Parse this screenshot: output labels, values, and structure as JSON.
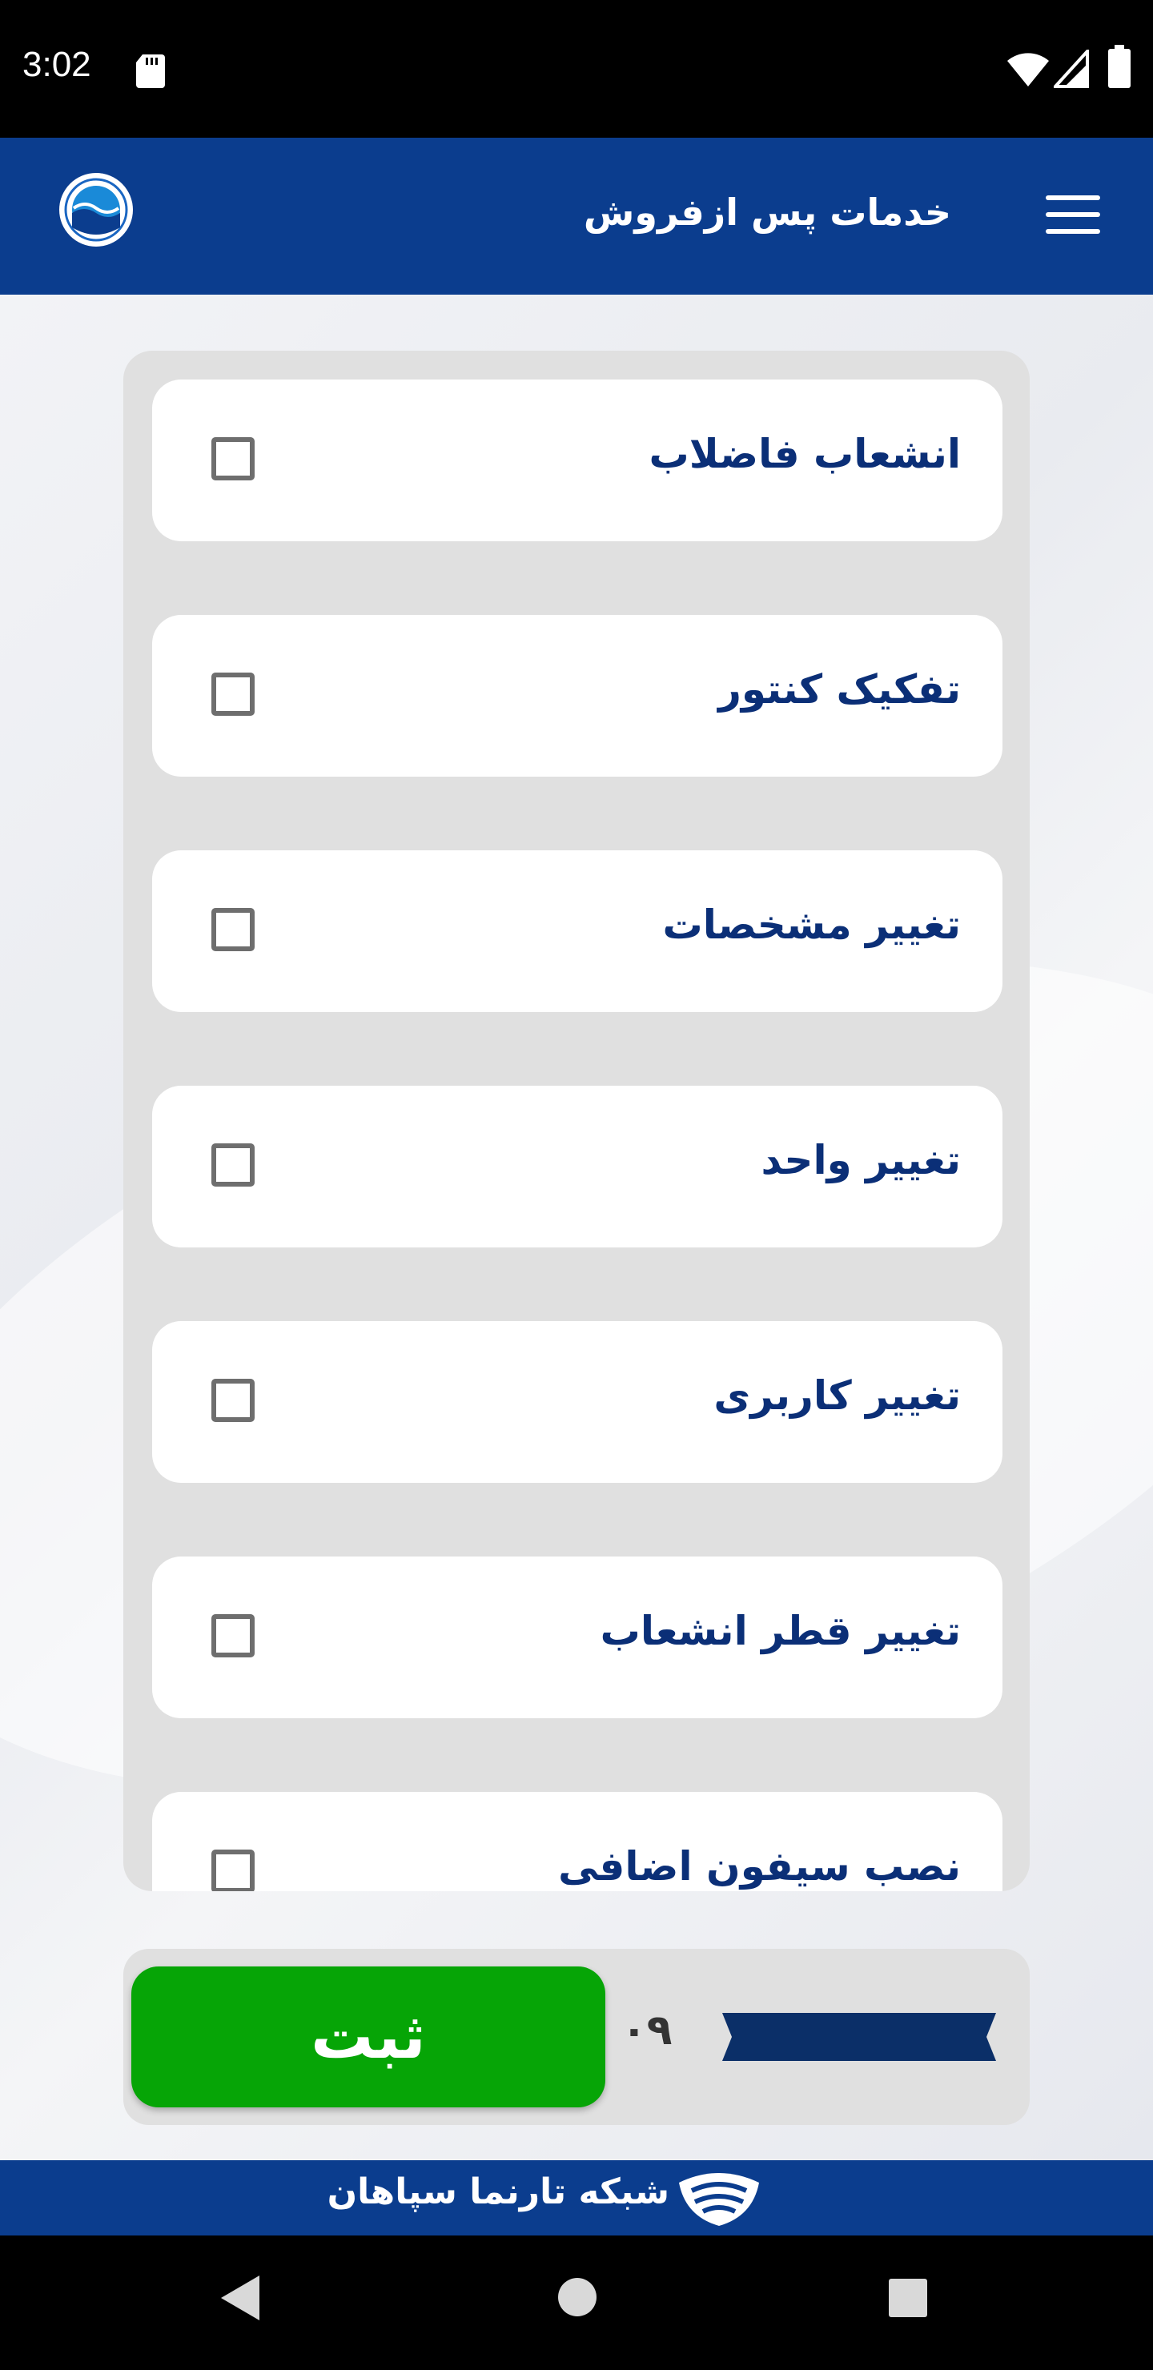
{
  "status_bar": {
    "time": "3:02",
    "icons": [
      "sd-card-icon",
      "wifi-icon",
      "signal-icon",
      "battery-icon"
    ]
  },
  "app_bar": {
    "title": "خدمات پس ازفروش",
    "menu_icon": "hamburger-menu-icon",
    "logo_icon": "water-company-logo"
  },
  "services": [
    {
      "label": "انشعاب فاضلاب",
      "checked": false
    },
    {
      "label": "تفکیک کنتور",
      "checked": false
    },
    {
      "label": "تغییر مشخصات",
      "checked": false
    },
    {
      "label": "تغییر واحد",
      "checked": false
    },
    {
      "label": "تغییر کاربری",
      "checked": false
    },
    {
      "label": "تغییر قطر انشعاب",
      "checked": false
    },
    {
      "label": "نصب سیفون اضافی",
      "checked": false
    }
  ],
  "action": {
    "submit_label": "ثبت",
    "phone_prefix": "۰۹"
  },
  "footer": {
    "brand_text": "شبکه تارنما سپاهان"
  },
  "colors": {
    "primary": "#0b3d8e",
    "submit": "#06a506",
    "label": "#0b2f77"
  }
}
